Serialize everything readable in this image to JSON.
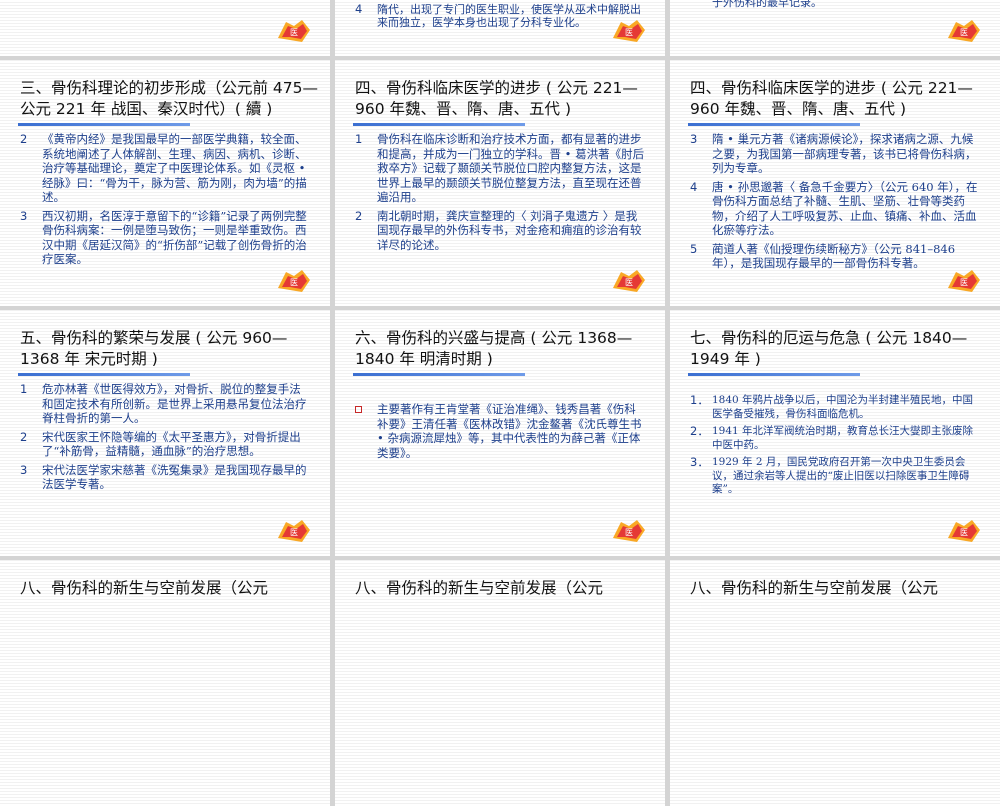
{
  "top": {
    "s1_frag": "",
    "s2_frag_num": "4",
    "s2_frag_text": "隋代，出现了专门的医生职业，使医学从巫术中解脱出来而独立，医学本身也出现了分科专业化。",
    "s3_frag_text": "于外伤科的最早记录。"
  },
  "s4": {
    "title": "三、骨伤科理论的初步形成（公元前 475—公元 221 年 战国、秦汉时代）( 續 )",
    "items": [
      {
        "num": "2",
        "text": "《黄帝内经》是我国最早的一部医学典籍，较全面、系统地阐述了人体解剖、生理、病因、病机、诊断、治疗等基础理论，奠定了中医理论体系。如《灵枢 • 经脉》曰：“骨为干，脉为营、筋为刚，肉为墙”的描述。"
      },
      {
        "num": "3",
        "text": "西汉初期，名医淳于意留下的“诊籍”记录了两例完整骨伤科病案：一例是堕马致伤；一则是举重致伤。西汉中期《居延汉简》的“折伤部”记载了创伤骨折的治疗医案。"
      }
    ]
  },
  "s5": {
    "title": "四、骨伤科临床医学的进步 ( 公元 221—960 年魏、晋、隋、唐、五代 )",
    "items": [
      {
        "num": "1",
        "text": "骨伤科在临床诊断和治疗技术方面，都有显著的进步和提高，并成为一门独立的学科。晋 • 葛洪著《肘后救卒方》记载了颞颌关节脱位口腔内整复方法，这是世界上最早的颞颌关节脱位整复方法，直至现在还普遍沿用。"
      },
      {
        "num": "2",
        "text": "南北朝时期，龚庆宣整理的〈 刘涓子鬼遗方 〉是我国现存最早的外伤科专书，对金疮和痈疽的诊治有较详尽的论述。"
      }
    ]
  },
  "s6": {
    "title": "四、骨伤科临床医学的进步 ( 公元 221—960 年魏、晋、隋、唐、五代 )",
    "items": [
      {
        "num": "3",
        "text": "隋 • 巢元方著《诸病源候论》，探求诸病之源、九候之要，为我国第一部病理专著，该书已将骨伤科病，列为专章。"
      },
      {
        "num": "4",
        "text": "唐 • 孙思邈著〈 备急千金要方〉（公元 640 年），在骨伤科方面总结了补髓、生肌、坚筋、壮骨等类药物，介绍了人工呼吸复苏、止血、镇痛、补血、活血化瘀等疗法。"
      },
      {
        "num": "5",
        "text": "蔺道人著《仙授理伤续断秘方》（公元 841–846 年），是我国现存最早的一部骨伤科专著。"
      }
    ]
  },
  "s7": {
    "title": "五、骨伤科的繁荣与发展 ( 公元 960—1368 年 宋元时期 )",
    "items": [
      {
        "num": "1",
        "text": "危亦林著《世医得效方》，对骨折、脱位的整复手法和固定技术有所创新。是世界上采用悬吊复位法治疗脊柱骨折的第一人。"
      },
      {
        "num": "2",
        "text": "宋代医家王怀隐等编的《太平圣惠方》，对骨折提出了“补筋骨，益精髓，通血脉”的治疗思想。"
      },
      {
        "num": "3",
        "text": "宋代法医学家宋慈著《洗冤集录》是我国现存最早的法医学专著。"
      }
    ]
  },
  "s8": {
    "title": "六、骨伤科的兴盛与提高 ( 公元 1368—1840 年  明清时期 )",
    "items": [
      {
        "num": "",
        "text": "主要著作有王肯堂著《证治准绳》、钱秀昌著《伤科补要》王清任著《医林改错》沈金鳌著《沈氏尊生书 • 杂病源流犀烛》等，其中代表性的为薛己著《正体类要》。"
      }
    ]
  },
  "s9": {
    "title": "七、骨伤科的厄运与危急 ( 公元 1840—1949 年 )",
    "items": [
      {
        "num": "1．",
        "text": "1840 年鸦片战争以后，中国沦为半封建半殖民地，中国医学备受摧残，骨伤科面临危机。"
      },
      {
        "num": "2．",
        "text": "1941 年北洋军阀统治时期，教育总长汪大燮即主张废除中医中药。"
      },
      {
        "num": "3．",
        "text": "1929 年 2 月，国民党政府召开第一次中央卫生委员会议，通过余岩等人提出的“废止旧医以扫除医事卫生障碍案”。"
      }
    ]
  },
  "bottom": {
    "s10_title": "八、骨伤科的新生与空前发展（公元",
    "s11_title": "八、骨伤科的新生与空前发展（公元",
    "s12_title": "八、骨伤科的新生与空前发展（公元"
  },
  "colors": {
    "body_text": "#1d3f8c",
    "rule_blue": "#3b6fd1",
    "logo_red": "#e53935",
    "logo_orange": "#f9a825"
  },
  "icons": {
    "logo": "publisher-logo-icon",
    "bullet": "hollow-square-bullet-icon"
  }
}
